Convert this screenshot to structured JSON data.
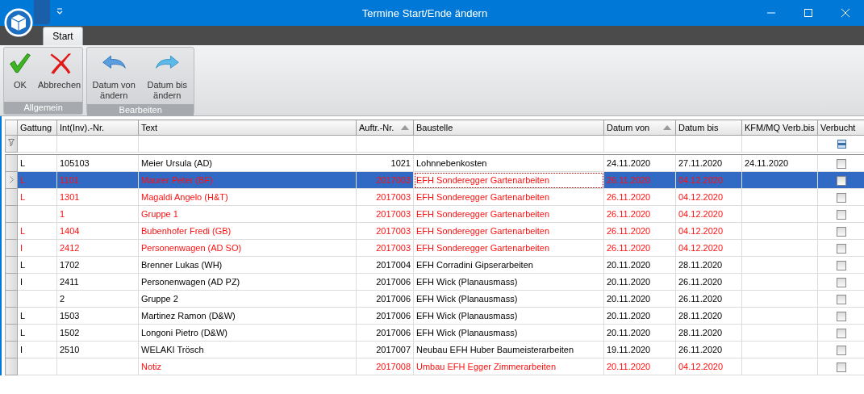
{
  "window": {
    "title": "Termine Start/Ende ändern"
  },
  "ribbon": {
    "tabs": [
      {
        "label": "Start",
        "selected": true
      }
    ],
    "groups": [
      {
        "label": "Allgemein",
        "buttons": [
          {
            "kind": "ok",
            "label": "OK"
          },
          {
            "kind": "cancel",
            "label": "Abbrechen"
          }
        ]
      },
      {
        "label": "Bearbeiten",
        "buttons": [
          {
            "kind": "back",
            "label": "Datum von ändern"
          },
          {
            "kind": "forward",
            "label": "Datum bis ändern"
          }
        ]
      }
    ]
  },
  "table": {
    "columns": [
      {
        "label": "Gattung",
        "sorted": false
      },
      {
        "label": "Int(Inv).-Nr.",
        "sorted": false
      },
      {
        "label": "Text",
        "sorted": false
      },
      {
        "label": "Auftr.-Nr.",
        "sorted": true
      },
      {
        "label": "Baustelle",
        "sorted": false
      },
      {
        "label": "Datum von",
        "sorted": true
      },
      {
        "label": "Datum bis",
        "sorted": false
      },
      {
        "label": "KFM/MQ Verb.bis",
        "sorted": false
      },
      {
        "label": "Verbucht",
        "sorted": false
      }
    ],
    "filter": {
      "verbucht_indeterminate": true
    },
    "rows": [
      {
        "cells": [
          "L",
          "105103",
          "Meier Ursula (AD)",
          "1021",
          "Lohnnebenkosten",
          "24.11.2020",
          "27.11.2020",
          "24.11.2020"
        ],
        "verbucht": false,
        "flagged": false,
        "selected": false
      },
      {
        "cells": [
          "L",
          "1101",
          "Maurer Peter (BF)",
          "2017003",
          "EFH Sonderegger Gartenarbeiten",
          "26.11.2020",
          "04.12.2020",
          ""
        ],
        "verbucht": false,
        "flagged": true,
        "selected": true
      },
      {
        "cells": [
          "L",
          "1301",
          "Magaldi Angelo (H&T)",
          "2017003",
          "EFH Sonderegger Gartenarbeiten",
          "26.11.2020",
          "04.12.2020",
          ""
        ],
        "verbucht": false,
        "flagged": true,
        "selected": false
      },
      {
        "cells": [
          "",
          "1",
          "Gruppe 1",
          "2017003",
          "EFH Sonderegger Gartenarbeiten",
          "26.11.2020",
          "04.12.2020",
          ""
        ],
        "verbucht": false,
        "flagged": true,
        "selected": false
      },
      {
        "cells": [
          "L",
          "1404",
          "Bubenhofer Fredi (GB)",
          "2017003",
          "EFH Sonderegger Gartenarbeiten",
          "26.11.2020",
          "04.12.2020",
          ""
        ],
        "verbucht": false,
        "flagged": true,
        "selected": false
      },
      {
        "cells": [
          "I",
          "2412",
          "Personenwagen (AD SO)",
          "2017003",
          "EFH Sonderegger Gartenarbeiten",
          "26.11.2020",
          "04.12.2020",
          ""
        ],
        "verbucht": false,
        "flagged": true,
        "selected": false
      },
      {
        "cells": [
          "L",
          "1702",
          "Brenner Lukas (WH)",
          "2017004",
          "EFH Corradini Gipserarbeiten",
          "20.11.2020",
          "28.11.2020",
          ""
        ],
        "verbucht": false,
        "flagged": false,
        "selected": false
      },
      {
        "cells": [
          "I",
          "2411",
          "Personenwagen (AD PZ)",
          "2017006",
          "EFH Wick (Planausmass)",
          "20.11.2020",
          "26.11.2020",
          ""
        ],
        "verbucht": false,
        "flagged": false,
        "selected": false
      },
      {
        "cells": [
          "",
          "2",
          "Gruppe 2",
          "2017006",
          "EFH Wick (Planausmass)",
          "20.11.2020",
          "26.11.2020",
          ""
        ],
        "verbucht": false,
        "flagged": false,
        "selected": false
      },
      {
        "cells": [
          "L",
          "1503",
          "Martinez Ramon (D&W)",
          "2017006",
          "EFH Wick (Planausmass)",
          "20.11.2020",
          "28.11.2020",
          ""
        ],
        "verbucht": false,
        "flagged": false,
        "selected": false
      },
      {
        "cells": [
          "L",
          "1502",
          "Longoni Pietro (D&W)",
          "2017006",
          "EFH Wick (Planausmass)",
          "20.11.2020",
          "28.11.2020",
          ""
        ],
        "verbucht": false,
        "flagged": false,
        "selected": false
      },
      {
        "cells": [
          "I",
          "2510",
          "WELAKI Trösch",
          "2017007",
          "Neubau EFH Huber Baumeisterarbeiten",
          "19.11.2020",
          "26.11.2020",
          ""
        ],
        "verbucht": false,
        "flagged": false,
        "selected": false
      },
      {
        "cells": [
          "",
          "",
          "Notiz",
          "2017008",
          "Umbau EFH Egger Zimmerarbeiten",
          "20.11.2020",
          "04.12.2020",
          ""
        ],
        "verbucht": false,
        "flagged": true,
        "selected": false
      }
    ]
  }
}
